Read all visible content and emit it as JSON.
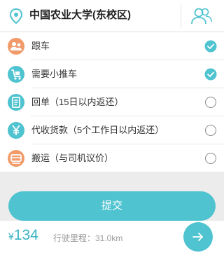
{
  "location": {
    "name": "中国农业大学(东校区)",
    "pin_icon": "location-pin-icon",
    "contacts_icon": "contacts-icon"
  },
  "options": [
    {
      "label": "跟车",
      "icon": "follow-car-icon",
      "icon_color": "#f19b6a",
      "checked": true
    },
    {
      "label": "需要小推车",
      "icon": "trolley-icon",
      "icon_color": "#4fc3cf",
      "checked": true
    },
    {
      "label": "回单（15日以内返还）",
      "icon": "receipt-icon",
      "icon_color": "#4fc3cf",
      "checked": false
    },
    {
      "label": "代收货款（5个工作日以内返还）",
      "icon": "yen-icon",
      "icon_color": "#4fc3cf",
      "checked": false
    },
    {
      "label": "搬运（与司机议价）",
      "icon": "porter-icon",
      "icon_color": "#f19b6a",
      "checked": false
    }
  ],
  "submit": {
    "label": "提交"
  },
  "footer": {
    "currency": "¥",
    "price": "134",
    "distance_text": "行驶里程：31.0km",
    "next_icon": "arrow-right-icon"
  },
  "colors": {
    "accent": "#4fc3cf",
    "orange": "#f19b6a",
    "background": "#ececec"
  }
}
